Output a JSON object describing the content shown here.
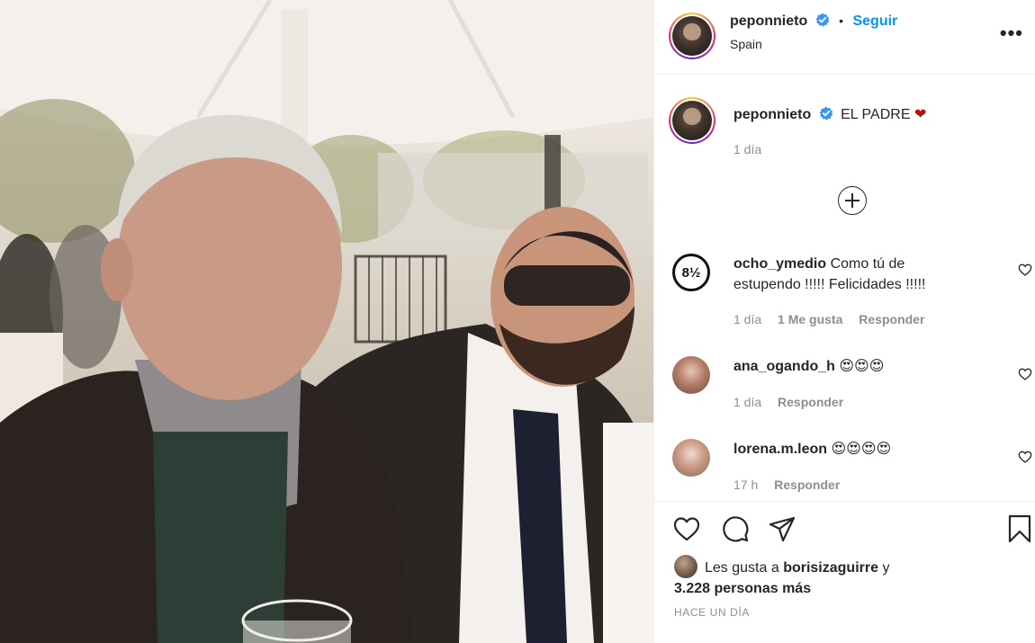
{
  "post": {
    "username": "peponnieto",
    "follow_label": "Seguir",
    "location": "Spain",
    "more_label": "•••",
    "caption_text": "EL PADRE",
    "caption_emoji": "❤",
    "caption_time": "1 día"
  },
  "comments": [
    {
      "username": "ocho_ymedio",
      "text": "Como tú de estupendo !!!!! Felicidades !!!!!",
      "avatar_text": "8½",
      "time": "1 día",
      "likes": "1 Me gusta",
      "reply": "Responder"
    },
    {
      "username": "ana_ogando_h",
      "text": "😍😍😍",
      "time": "1 día",
      "reply": "Responder"
    },
    {
      "username": "lorena.m.leon",
      "text": "😍😍😍😍",
      "time": "17 h",
      "reply": "Responder"
    }
  ],
  "likes": {
    "prefix": "Les gusta a",
    "user": "borisizaguirre",
    "conjunction": "y",
    "others": "3.228 personas más"
  },
  "timestamp": "HACE UN DÍA",
  "icons": [
    "verified-badge",
    "more-options-icon",
    "add-comment-icon",
    "heart-icon",
    "comment-icon",
    "share-icon",
    "bookmark-icon"
  ],
  "colors": {
    "accent": "#0095f6",
    "secondary_text": "#8e8e8e",
    "heart_red": "#b30f0f"
  }
}
